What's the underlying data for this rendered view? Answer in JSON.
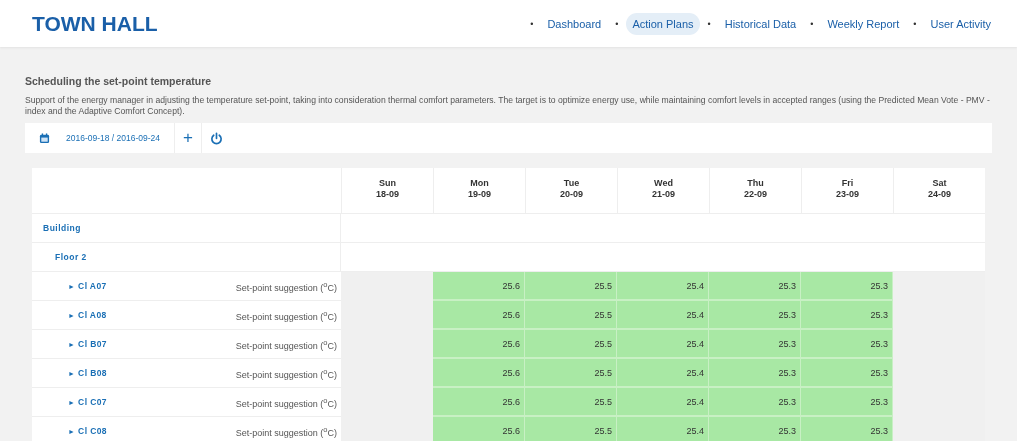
{
  "header": {
    "title": "TOWN HALL",
    "nav_lead": "•",
    "nav": [
      {
        "label": "Dashboard",
        "separator": "•",
        "selected": false
      },
      {
        "label": "Action Plans",
        "separator": "•",
        "selected": true
      },
      {
        "label": "Historical Data",
        "separator": "•",
        "selected": false
      },
      {
        "label": "Weekly Report",
        "separator": "•",
        "selected": false
      },
      {
        "label": "User Activity",
        "selected": false
      }
    ]
  },
  "section": {
    "title": "Scheduling the set-point temperature",
    "description": "Support of the energy manager in adjusting the temperature set-point, taking into consideration thermal comfort parameters. The target is to optimize energy use, while maintaining comfort levels in accepted ranges (using the Predicted Mean Vote - PMV - index and the Adaptive Comfort Concept)."
  },
  "toolbar": {
    "date_range": "2016-09-18 / 2016-09-24",
    "add_label": "+"
  },
  "table": {
    "columns": [
      {
        "day": "Sun",
        "date": "18-09"
      },
      {
        "day": "Mon",
        "date": "19-09"
      },
      {
        "day": "Tue",
        "date": "20-09"
      },
      {
        "day": "Wed",
        "date": "21-09"
      },
      {
        "day": "Thu",
        "date": "22-09"
      },
      {
        "day": "Fri",
        "date": "23-09"
      },
      {
        "day": "Sat",
        "date": "24-09"
      }
    ],
    "building": {
      "name": "Building",
      "floors": [
        {
          "name": "Floor 2",
          "rooms": [
            {
              "expander": "►",
              "name": "Cl A07",
              "metric": "Set-point suggestion ($^{o}$C)",
              "cells": [
                {
                  "kind": "empty"
                },
                {
                  "kind": "value",
                  "value": "25.6"
                },
                {
                  "kind": "value",
                  "value": "25.5"
                },
                {
                  "kind": "value",
                  "value": "25.4"
                },
                {
                  "kind": "value",
                  "value": "25.3"
                },
                {
                  "kind": "value",
                  "value": "25.3"
                },
                {
                  "kind": "empty"
                }
              ]
            },
            {
              "expander": "►",
              "name": "Cl A08",
              "metric": "Set-point suggestion ($^{o}$C)",
              "cells": [
                {
                  "kind": "empty"
                },
                {
                  "kind": "value",
                  "value": "25.6"
                },
                {
                  "kind": "value",
                  "value": "25.5"
                },
                {
                  "kind": "value",
                  "value": "25.4"
                },
                {
                  "kind": "value",
                  "value": "25.3"
                },
                {
                  "kind": "value",
                  "value": "25.3"
                },
                {
                  "kind": "empty"
                }
              ]
            },
            {
              "expander": "►",
              "name": "Cl B07",
              "metric": "Set-point suggestion ($^{o}$C)",
              "cells": [
                {
                  "kind": "empty"
                },
                {
                  "kind": "value",
                  "value": "25.6"
                },
                {
                  "kind": "value",
                  "value": "25.5"
                },
                {
                  "kind": "value",
                  "value": "25.4"
                },
                {
                  "kind": "value",
                  "value": "25.3"
                },
                {
                  "kind": "value",
                  "value": "25.3"
                },
                {
                  "kind": "empty"
                }
              ]
            },
            {
              "expander": "►",
              "name": "Cl B08",
              "metric": "Set-point suggestion ($^{o}$C)",
              "cells": [
                {
                  "kind": "empty"
                },
                {
                  "kind": "value",
                  "value": "25.6"
                },
                {
                  "kind": "value",
                  "value": "25.5"
                },
                {
                  "kind": "value",
                  "value": "25.4"
                },
                {
                  "kind": "value",
                  "value": "25.3"
                },
                {
                  "kind": "value",
                  "value": "25.3"
                },
                {
                  "kind": "empty"
                }
              ]
            },
            {
              "expander": "►",
              "name": "Cl C07",
              "metric": "Set-point suggestion ($^{o}$C)",
              "cells": [
                {
                  "kind": "empty"
                },
                {
                  "kind": "value",
                  "value": "25.6"
                },
                {
                  "kind": "value",
                  "value": "25.5"
                },
                {
                  "kind": "value",
                  "value": "25.4"
                },
                {
                  "kind": "value",
                  "value": "25.3"
                },
                {
                  "kind": "value",
                  "value": "25.3"
                },
                {
                  "kind": "empty"
                }
              ]
            },
            {
              "expander": "►",
              "name": "Cl C08",
              "metric": "Set-point suggestion ($^{o}$C)",
              "cells": [
                {
                  "kind": "empty"
                },
                {
                  "kind": "value",
                  "value": "25.6"
                },
                {
                  "kind": "value",
                  "value": "25.5"
                },
                {
                  "kind": "value",
                  "value": "25.4"
                },
                {
                  "kind": "value",
                  "value": "25.3"
                },
                {
                  "kind": "value",
                  "value": "25.3"
                },
                {
                  "kind": "empty"
                }
              ]
            }
          ]
        }
      ]
    }
  }
}
